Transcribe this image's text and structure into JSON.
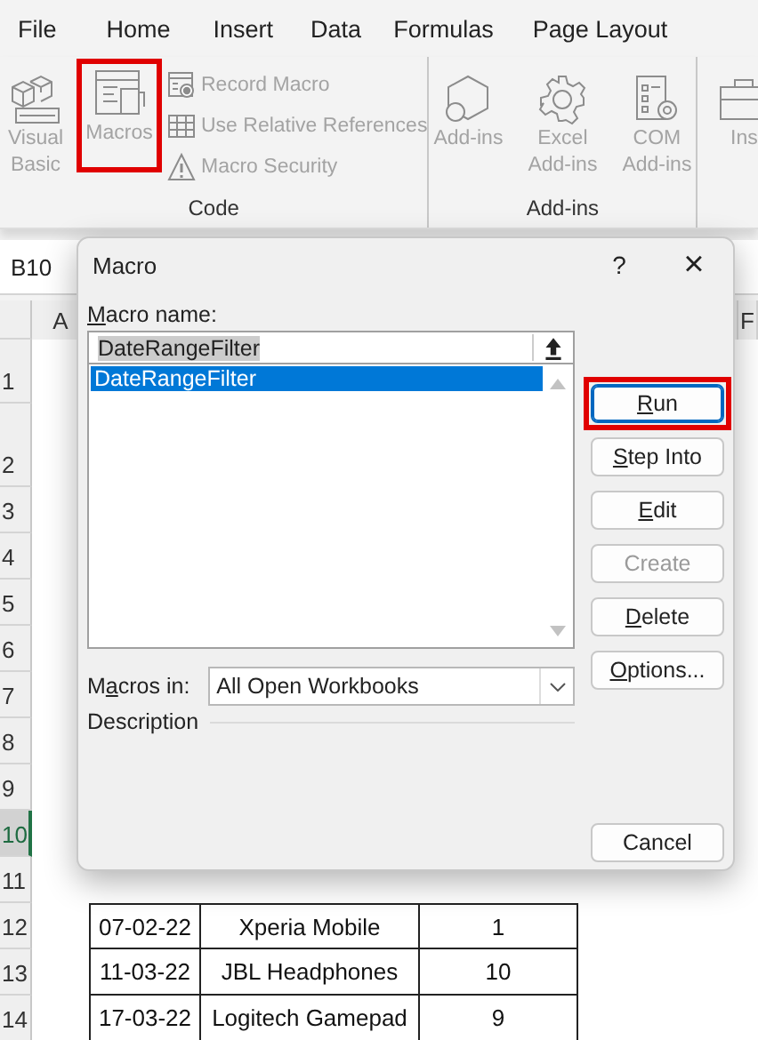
{
  "ribbon": {
    "tabs": [
      {
        "label": "File",
        "selected": false
      },
      {
        "label": "Home",
        "selected": false
      },
      {
        "label": "Insert",
        "selected": false
      },
      {
        "label": "Data",
        "selected": false
      },
      {
        "label": "Formulas",
        "selected": false
      },
      {
        "label": "Page Layout",
        "selected": false
      }
    ],
    "groups": [
      {
        "label": "Code",
        "items": [
          {
            "kind": "large",
            "label": "Visual Basic",
            "disabled": true,
            "highlighted": false
          },
          {
            "kind": "large",
            "label": "Macros",
            "disabled": true,
            "highlighted": true
          },
          {
            "kind": "stack",
            "items": [
              {
                "label": "Record Macro",
                "disabled": true
              },
              {
                "label": "Use Relative References",
                "disabled": true
              },
              {
                "label": "Macro Security",
                "disabled": true
              }
            ]
          }
        ]
      },
      {
        "label": "Add-ins",
        "items": [
          {
            "kind": "large",
            "label": "Add-ins",
            "disabled": true,
            "highlighted": false
          },
          {
            "kind": "large",
            "label": "Excel Add-ins",
            "disabled": true,
            "highlighted": false
          },
          {
            "kind": "large",
            "label": "COM Add-ins",
            "disabled": true,
            "highlighted": false
          }
        ]
      },
      {
        "items": [
          {
            "kind": "large",
            "label": "Ins",
            "disabled": true,
            "highlighted": false
          }
        ]
      }
    ]
  },
  "name_box": "B10",
  "sheet": {
    "column_headers": [
      {
        "label": "A"
      },
      {
        "label": "F"
      }
    ],
    "row_headers": [
      {
        "label": "1",
        "selected": false
      },
      {
        "label": "2",
        "selected": false
      },
      {
        "label": "3",
        "selected": false
      },
      {
        "label": "4",
        "selected": false
      },
      {
        "label": "5",
        "selected": false
      },
      {
        "label": "6",
        "selected": false
      },
      {
        "label": "7",
        "selected": false
      },
      {
        "label": "8",
        "selected": false
      },
      {
        "label": "9",
        "selected": false
      },
      {
        "label": "10",
        "selected": true
      },
      {
        "label": "11",
        "selected": false
      },
      {
        "label": "12",
        "selected": false
      },
      {
        "label": "13",
        "selected": false
      },
      {
        "label": "14",
        "selected": false
      }
    ],
    "table_rows": [
      {
        "cells": [
          "07-02-22",
          "Xperia Mobile",
          "1"
        ]
      },
      {
        "cells": [
          "11-03-22",
          "JBL Headphones",
          "10"
        ]
      },
      {
        "cells": [
          "17-03-22",
          "Logitech Gamepad",
          "9"
        ]
      }
    ]
  },
  "dialog": {
    "title": "Macro",
    "help": "?",
    "close": "×",
    "name_label": {
      "key": "M",
      "post": "acro name:"
    },
    "name_value": "DateRangeFilter",
    "macros": [
      {
        "label": "DateRangeFilter",
        "selected": true
      }
    ],
    "macros_in_label": {
      "pre": "M",
      "key": "a",
      "post": "cros in:"
    },
    "macros_in_value": "All Open Workbooks",
    "description_label": "Description",
    "buttons": [
      {
        "key": "R",
        "post": "un",
        "disabled": false,
        "highlighted": true
      },
      {
        "key": "S",
        "post": "tep Into",
        "disabled": false,
        "highlighted": false
      },
      {
        "key": "E",
        "post": "dit",
        "disabled": false,
        "highlighted": false
      },
      {
        "post": "Create",
        "disabled": true,
        "highlighted": false
      },
      {
        "key": "D",
        "post": "elete",
        "disabled": false,
        "highlighted": false
      },
      {
        "key": "O",
        "post": "ptions...",
        "disabled": false,
        "highlighted": false
      }
    ],
    "cancel": "Cancel"
  }
}
